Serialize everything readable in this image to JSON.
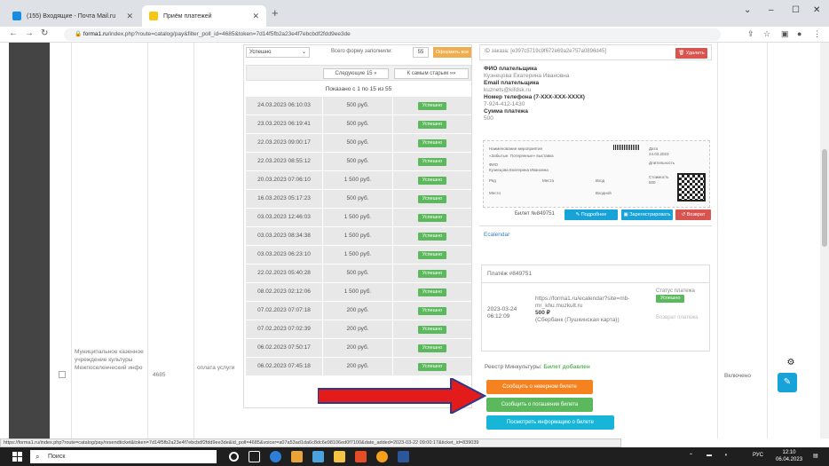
{
  "browser": {
    "tabs": [
      {
        "title": "(155) Входящие - Почта Mail.ru"
      },
      {
        "title": "Приём платежей"
      }
    ],
    "new_tab": "+",
    "url_host": "forma1.ru",
    "url_rest": "/index.php?route=catalog/pay&filter_poll_id=4685&token=7d14f5fb2a23e4f7ebcbdf2fdd9ee3de",
    "window_controls": [
      "⌄",
      "–",
      "☐",
      "✕"
    ]
  },
  "left_row": {
    "org": "Муниципальное казенное учреждение культуры Межпоселенческий инфо",
    "id": "4685",
    "payment_type": "оплата услуги"
  },
  "payments": {
    "status_select": "Успешно",
    "total_label": "Всего форму заполнили:",
    "total_value": "55",
    "orders_button": "Оформить все",
    "next_button": "Следующие 15 »",
    "to_old_button": "К самым старым »»",
    "showing_text": "Показано с 1 по 15 из 55",
    "rows": [
      {
        "date": "24.03.2023 06:10:03",
        "amount": "500 руб.",
        "status": "Успешно"
      },
      {
        "date": "23.03.2023 06:19:41",
        "amount": "500 руб.",
        "status": "Успешно"
      },
      {
        "date": "22.03.2023 09:00:17",
        "amount": "500 руб.",
        "status": "Успешно"
      },
      {
        "date": "22.03.2023 08:55:12",
        "amount": "500 руб.",
        "status": "Успешно"
      },
      {
        "date": "20.03.2023 07:06:10",
        "amount": "1 500 руб.",
        "status": "Успешно"
      },
      {
        "date": "16.03.2023 05:17:23",
        "amount": "500 руб.",
        "status": "Успешно"
      },
      {
        "date": "03.03.2023 12:46:03",
        "amount": "1 500 руб.",
        "status": "Успешно"
      },
      {
        "date": "03.03.2023 08:34:38",
        "amount": "1 500 руб.",
        "status": "Успешно"
      },
      {
        "date": "03.03.2023 06:23:10",
        "amount": "1 500 руб.",
        "status": "Успешно"
      },
      {
        "date": "22.02.2023 05:40:28",
        "amount": "500 руб.",
        "status": "Успешно"
      },
      {
        "date": "08.02.2023 02:12:06",
        "amount": "1 500 руб.",
        "status": "Успешно"
      },
      {
        "date": "07.02.2023 07:07:18",
        "amount": "200 руб.",
        "status": "Успешно"
      },
      {
        "date": "07.02.2023 07:02:39",
        "amount": "200 руб.",
        "status": "Успешно"
      },
      {
        "date": "06.02.2023 07:50:17",
        "amount": "200 руб.",
        "status": "Успешно"
      },
      {
        "date": "06.02.2023 07:45:18",
        "amount": "200 руб.",
        "status": "Успешно"
      }
    ]
  },
  "order": {
    "id_text": "ID заказа: [e397c5719c9f672e69a2e757a0896d45]",
    "delete_button": "Удалить",
    "payer_name_label": "ФИО плательщика",
    "payer_name": "Кузнецова Екатерина Ивановна",
    "email_label": "Email плательщика",
    "email": "kuznets@kifdsk.ru",
    "phone_label": "Номер телефона (7-XXX-XXX-XXXX)",
    "phone": "7-924-412-1430",
    "sum_label": "Сумма платежа",
    "sum": "500",
    "ticket": {
      "event_label": "Наименование мероприятия",
      "event": "«Забытые. Потерянные» выставка",
      "buyer_label": "ФИО",
      "buyer": "Кузнецова Екатерина Ивановна",
      "date_label": "Дата",
      "place_label": "Место",
      "place_label2": "Вход",
      "price_label": "Стоимость",
      "row_label": "Ряд",
      "seat_label": "Места",
      "duration_label": "Длительность",
      "date_value": "24.03.2023",
      "price_value": "500",
      "ticket_type": "Входной"
    },
    "ticket_no": "Билет №849751",
    "resend_button": "Подробнее",
    "register_button": "Зарегистрировать",
    "cancel_button": "Возврат",
    "calendar_link": "Ecalendar",
    "payment_header": "Платёж #849751",
    "payment_date": "2023-03-24 06:12:09",
    "payment_link": "https://forma1.ru/ecalendar?site=mb-mr_khu.muzkult.ru",
    "payment_amount": "500 ₽",
    "payment_method": "(Сбербанк (Пушкинская карта))",
    "status_label": "Статус платежа",
    "status_value": "Успешно",
    "status_extra": "Возврат платежа",
    "registry_label": "Реестр Минкультуры:",
    "registry_value": "Билет добавлен",
    "btn_wrong_ticket": "Сообщить о неверном билете",
    "btn_visited": "Сообщить о погашении билета",
    "btn_refresh": "Посмотреть информацию о билете"
  },
  "right": {
    "enabled_text": "Включено"
  },
  "status_url": "https://forma1.ru/index.php?route=catalog/pay/resendticket&token=7d14f5fb2a23e4f7ebcbdf2fdd9ee3de&id_poll=4685&voicer=a07a53ad1da6c8dc6e98106ed0f7100&date_added=2023-03-22 09:00:17&ticket_id=839039",
  "taskbar": {
    "search_placeholder": "Поиск",
    "lang": "РУС",
    "time": "12:10",
    "date": "06.04.2023"
  },
  "colors": {
    "accent_red": "#e31b1b",
    "success": "#5cb85c",
    "warning": "#f0ad4e",
    "info": "#17a2d8"
  }
}
